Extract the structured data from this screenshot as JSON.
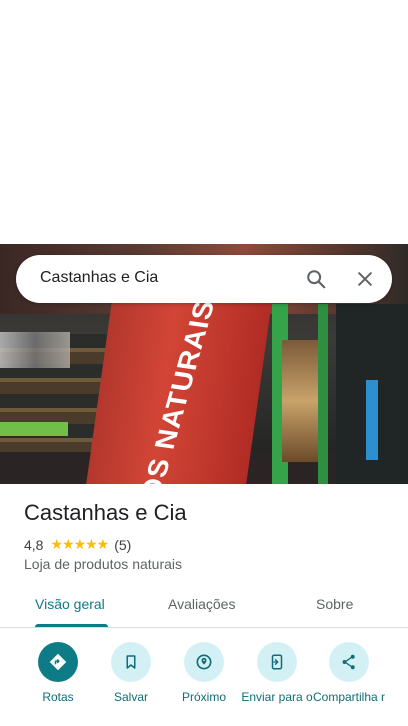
{
  "search": {
    "query": "Castanhas e Cia"
  },
  "photo": {
    "banner_text": "OS NATURAIS"
  },
  "place": {
    "name": "Castanhas e Cia",
    "rating": "4,8",
    "stars": "★★★★★",
    "reviews": "(5)",
    "category": "Loja de produtos naturais"
  },
  "tabs": [
    {
      "label": "Visão geral",
      "active": true
    },
    {
      "label": "Avaliações",
      "active": false
    },
    {
      "label": "Sobre",
      "active": false
    }
  ],
  "actions": [
    {
      "label": "Rotas",
      "icon": "directions-icon"
    },
    {
      "label": "Salvar",
      "icon": "bookmark-icon"
    },
    {
      "label": "Próximo",
      "icon": "nearby-icon"
    },
    {
      "label": "Enviar para o",
      "icon": "send-to-phone-icon"
    },
    {
      "label": "Compartilha r",
      "icon": "share-icon"
    }
  ],
  "colors": {
    "accent": "#0e7c86",
    "accent_light": "#d3f1f5",
    "star": "#fbbc04"
  }
}
